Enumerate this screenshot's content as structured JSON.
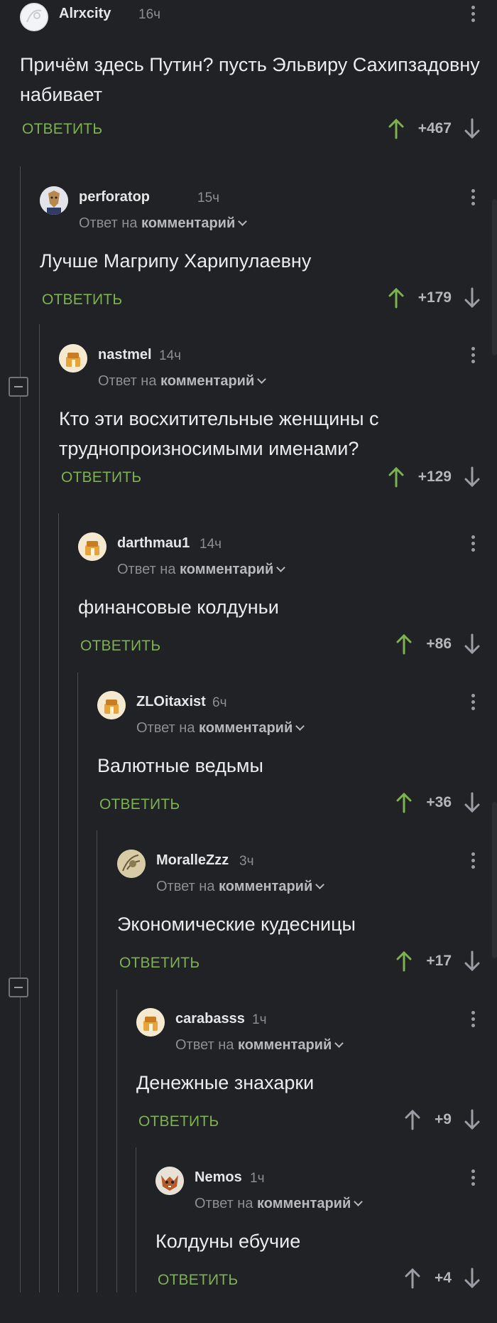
{
  "thread": {
    "collapse_label": "−",
    "comments": [
      {
        "id": "c1",
        "author": "Alrxcity",
        "time": "16ч",
        "text": "Причём здесь Путин? пусть Эльвиру Сахипзадовну набивает",
        "reply_label": "ОТВЕТИТЬ",
        "score": "+467",
        "reply_to": "",
        "avatar": "avatar-alrxcity",
        "vote_color": "#7cb24f"
      },
      {
        "id": "c2",
        "author": "perforatop",
        "time": "15ч",
        "reply_to_prefix": "Ответ на",
        "reply_to_target": "комментарий",
        "text": "Лучше Магрипу Харипулаевну",
        "reply_label": "ОТВЕТИТЬ",
        "score": "+179",
        "avatar": "avatar-perforatop",
        "vote_color": "#7cb24f"
      },
      {
        "id": "c3",
        "author": "nastmel",
        "time": "14ч",
        "reply_to_prefix": "Ответ на",
        "reply_to_target": "комментарий",
        "text": "Кто эти восхитительные женщины с труднопроизносимыми именами?",
        "reply_label": "ОТВЕТИТЬ",
        "score": "+129",
        "avatar": "avatar-nastmel",
        "vote_color": "#7cb24f"
      },
      {
        "id": "c4",
        "author": "darthmau1",
        "time": "14ч",
        "reply_to_prefix": "Ответ на",
        "reply_to_target": "комментарий",
        "text": "финансовые колдуньи",
        "reply_label": "ОТВЕТИТЬ",
        "score": "+86",
        "avatar": "avatar-darthmau1",
        "vote_color": "#7cb24f"
      },
      {
        "id": "c5",
        "author": "ZLOitaxist",
        "time": "6ч",
        "reply_to_prefix": "Ответ на",
        "reply_to_target": "комментарий",
        "text": "Валютные ведьмы",
        "reply_label": "ОТВЕТИТЬ",
        "score": "+36",
        "avatar": "avatar-zloitaxist",
        "vote_color": "#7cb24f"
      },
      {
        "id": "c6",
        "author": "MoralleZzz",
        "time": "3ч",
        "reply_to_prefix": "Ответ на",
        "reply_to_target": "комментарий",
        "text": "Экономические кудесницы",
        "reply_label": "ОТВЕТИТЬ",
        "score": "+17",
        "avatar": "avatar-moraллеzzz",
        "vote_color": "#7cb24f"
      },
      {
        "id": "c7",
        "author": "carabasss",
        "time": "1ч",
        "reply_to_prefix": "Ответ на",
        "reply_to_target": "комментарий",
        "text": "Денежные знахарки",
        "reply_label": "ОТВЕТИТЬ",
        "score": "+9",
        "avatar": "avatar-carabasss",
        "vote_color": "#9a9da3"
      },
      {
        "id": "c8",
        "author": "Nemos",
        "time": "1ч",
        "reply_to_prefix": "Ответ на",
        "reply_to_target": "комментарий",
        "text": "Колдуны ебучие",
        "reply_label": "ОТВЕТИТЬ",
        "score": "+4",
        "avatar": "avatar-nemos",
        "vote_color": "#9a9da3"
      }
    ]
  }
}
